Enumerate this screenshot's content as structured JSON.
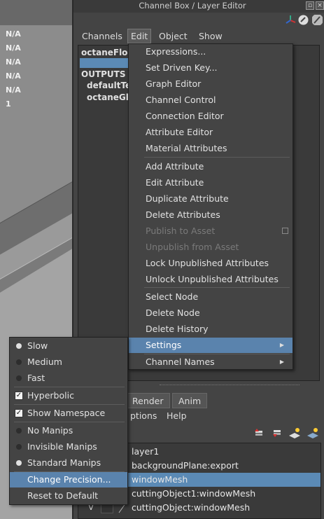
{
  "viewport": {
    "hud_values": [
      "N/A",
      "N/A",
      "N/A",
      "N/A",
      "N/A",
      "1"
    ]
  },
  "panel": {
    "title": "Channel Box / Layer Editor",
    "menubar": [
      "Channels",
      "Edit",
      "Object",
      "Show"
    ],
    "channel_box": {
      "node_name": "octaneFloa",
      "outputs_header": "OUTPUTS",
      "outputs": [
        "defaultTe",
        "octaneGlo"
      ]
    },
    "tabs": [
      "Render",
      "Anim"
    ],
    "layer_menu": [
      "ptions",
      "Help"
    ],
    "layers": [
      {
        "vis": "",
        "name": "layer1"
      },
      {
        "vis": "",
        "name": "backgroundPlane:export"
      },
      {
        "vis": "",
        "name": "windowMesh"
      },
      {
        "vis": "",
        "name": "cuttingObject1:windowMesh"
      },
      {
        "vis": "V",
        "name": "cuttingObject:windowMesh"
      }
    ]
  },
  "edit_menu": {
    "items": [
      {
        "label": "Expressions..."
      },
      {
        "label": "Set Driven Key..."
      },
      {
        "label": "Graph Editor"
      },
      {
        "label": "Channel Control"
      },
      {
        "label": "Connection Editor"
      },
      {
        "label": "Attribute Editor"
      },
      {
        "label": "Material Attributes"
      },
      {
        "label": "Add Attribute"
      },
      {
        "label": "Edit Attribute"
      },
      {
        "label": "Duplicate Attribute"
      },
      {
        "label": "Delete Attributes"
      },
      {
        "label": "Publish to Asset"
      },
      {
        "label": "Unpublish from Asset"
      },
      {
        "label": "Lock Unpublished Attributes"
      },
      {
        "label": "Unlock Unpublished Attributes"
      },
      {
        "label": "Select Node"
      },
      {
        "label": "Delete Node"
      },
      {
        "label": "Delete History"
      },
      {
        "label": "Settings"
      },
      {
        "label": "Channel Names"
      }
    ]
  },
  "settings_submenu": {
    "items": [
      {
        "label": "Slow",
        "type": "radio",
        "checked": true
      },
      {
        "label": "Medium",
        "type": "radio",
        "checked": false
      },
      {
        "label": "Fast",
        "type": "radio",
        "checked": false
      },
      {
        "label": "Hyperbolic",
        "type": "check",
        "checked": true
      },
      {
        "label": "Show Namespace",
        "type": "check",
        "checked": true
      },
      {
        "label": "No Manips",
        "type": "radio",
        "checked": false
      },
      {
        "label": "Invisible Manips",
        "type": "radio",
        "checked": false
      },
      {
        "label": "Standard Manips",
        "type": "radio",
        "checked": true
      },
      {
        "label": "Change Precision..."
      },
      {
        "label": "Reset to Default"
      }
    ]
  },
  "colors": {
    "highlight": "#5a83ad",
    "selection": "#5b8ab5",
    "menu_bg": "#444444",
    "disabled_text": "#7a7a7a"
  }
}
